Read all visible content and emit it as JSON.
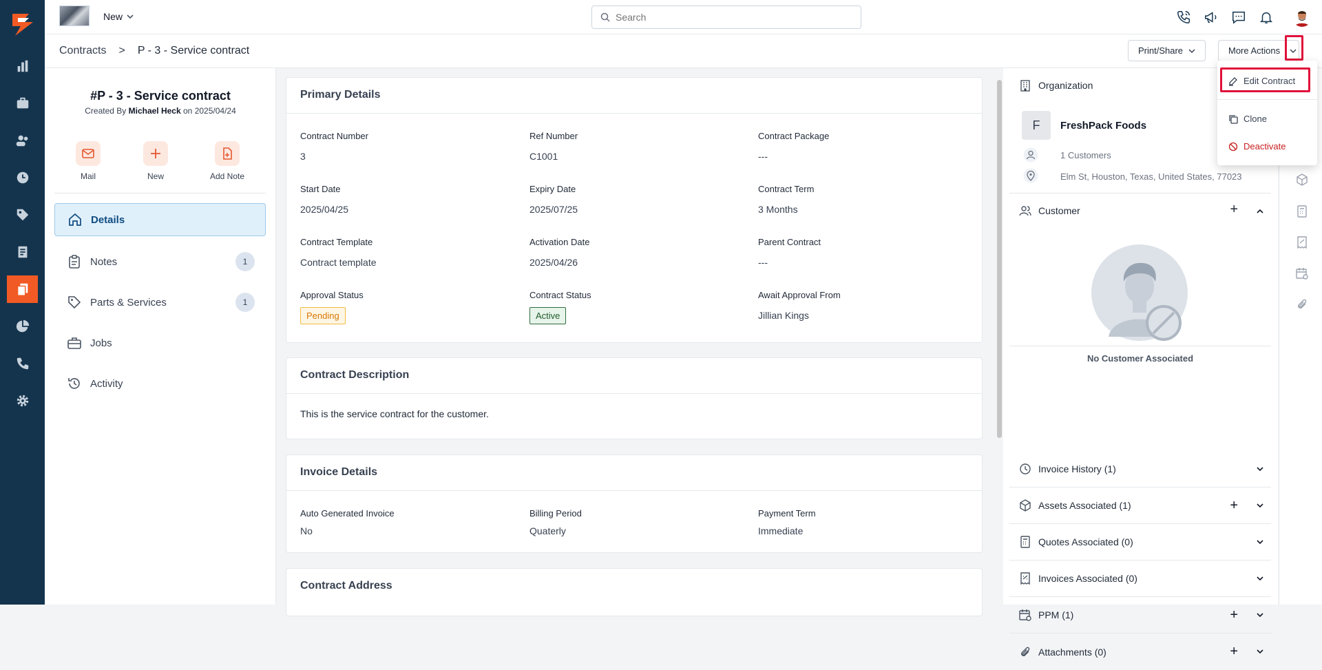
{
  "topbar": {
    "new_label": "New",
    "search_placeholder": "Search"
  },
  "breadcrumb": {
    "root": "Contracts",
    "separator": ">",
    "current": "P - 3 - Service contract"
  },
  "actions": {
    "print_share": "Print/Share",
    "more_actions": "More Actions"
  },
  "dropdown": {
    "items": [
      {
        "label": "Edit Contract",
        "color": "#374151"
      },
      {
        "label": "Clone",
        "color": "#374151"
      },
      {
        "label": "Deactivate",
        "color": "#c81e1e"
      }
    ]
  },
  "record": {
    "title": "#P - 3 - Service contract",
    "created_prefix": "Created By",
    "created_by": "Michael Heck",
    "created_on_prefix": "on",
    "created_on": "2025/04/24"
  },
  "quick_actions": [
    {
      "label": "Mail"
    },
    {
      "label": "New"
    },
    {
      "label": "Add Note"
    }
  ],
  "nav": [
    {
      "label": "Details"
    },
    {
      "label": "Notes",
      "count": "1"
    },
    {
      "label": "Parts & Services",
      "count": "1"
    },
    {
      "label": "Jobs"
    },
    {
      "label": "Activity"
    }
  ],
  "primary": {
    "title": "Primary Details",
    "fields": [
      {
        "k": "Contract Number",
        "v": "3"
      },
      {
        "k": "Ref Number",
        "v": "C1001"
      },
      {
        "k": "Contract Package",
        "v": "---"
      },
      {
        "k": "Start Date",
        "v": "2025/04/25"
      },
      {
        "k": "Expiry Date",
        "v": "2025/07/25"
      },
      {
        "k": "Contract Term",
        "v": "3 Months"
      },
      {
        "k": "Contract Template",
        "v": "Contract template"
      },
      {
        "k": "Activation Date",
        "v": "2025/04/26"
      },
      {
        "k": "Parent Contract",
        "v": "---"
      },
      {
        "k": "Approval Status",
        "v": "Pending"
      },
      {
        "k": "Contract Status",
        "v": "Active"
      },
      {
        "k": "Await Approval From",
        "v": "Jillian Kings"
      }
    ]
  },
  "description": {
    "title": "Contract Description",
    "text": "This is the service contract for the customer."
  },
  "invoice": {
    "title": "Invoice Details",
    "fields": [
      {
        "k": "Auto Generated Invoice",
        "v": "No"
      },
      {
        "k": "Billing Period",
        "v": "Quaterly"
      },
      {
        "k": "Payment Term",
        "v": "Immediate"
      }
    ]
  },
  "address": {
    "title": "Contract Address"
  },
  "right": {
    "org_header": "Organization",
    "org_initial": "F",
    "org_name": "FreshPack Foods",
    "customers": "1 Customers",
    "address": "Elm St, Houston, Texas, United States, 77023",
    "customer_header": "Customer",
    "no_customer": "No Customer Associated",
    "sections": [
      "Invoice History (1)",
      "Assets Associated (1)",
      "Quotes Associated (0)",
      "Invoices Associated (0)",
      "PPM (1)",
      "Attachments (0)"
    ],
    "plus": "+"
  },
  "colors": {
    "sidebar": "#14344e",
    "accent": "#f15a24",
    "highlight": "#e0103a"
  }
}
